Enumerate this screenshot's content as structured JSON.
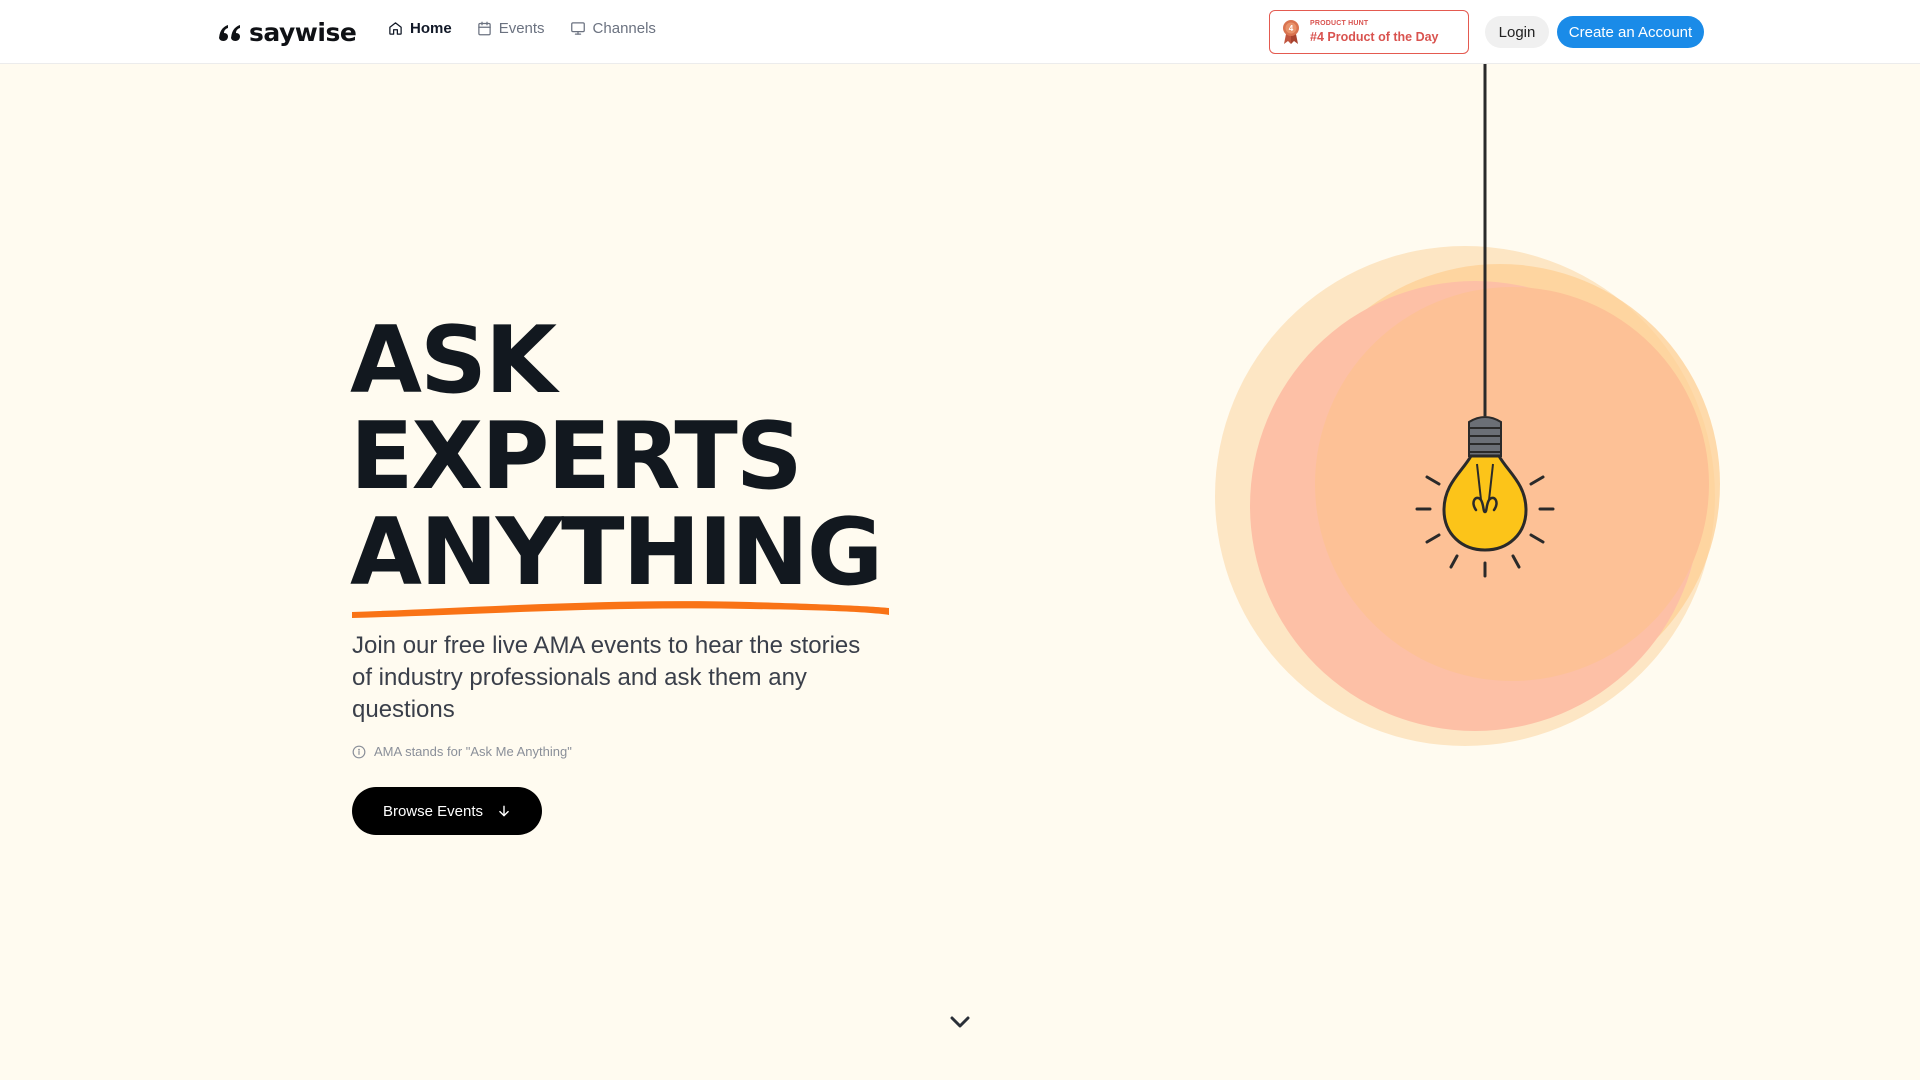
{
  "brand": {
    "name": "saywise"
  },
  "nav": {
    "items": [
      {
        "label": "Home",
        "icon": "home-icon",
        "active": true
      },
      {
        "label": "Events",
        "icon": "calendar-icon",
        "active": false
      },
      {
        "label": "Channels",
        "icon": "monitor-icon",
        "active": false
      }
    ]
  },
  "product_hunt": {
    "small_label": "PRODUCT HUNT",
    "rank_label": "#4 Product of the Day",
    "medal_number": "4",
    "color": "#d9534f"
  },
  "auth": {
    "login_label": "Login",
    "signup_label": "Create an Account"
  },
  "hero": {
    "title_lines": [
      "ASK",
      "EXPERTS",
      "ANYTHING"
    ],
    "subtitle": "Join our free live AMA events to hear the stories of industry professionals and ask them any questions",
    "note": "AMA stands for \"Ask Me Anything\"",
    "cta_label": "Browse Events"
  },
  "colors": {
    "background": "#fffbf0",
    "accent_orange": "#f97316",
    "primary_blue": "#1a8be8",
    "bulb_yellow": "#fcc419"
  },
  "icons": [
    "home-icon",
    "calendar-icon",
    "monitor-icon",
    "medal-icon",
    "info-icon",
    "arrow-down-icon",
    "lightbulb-icon",
    "chevron-down-icon"
  ]
}
